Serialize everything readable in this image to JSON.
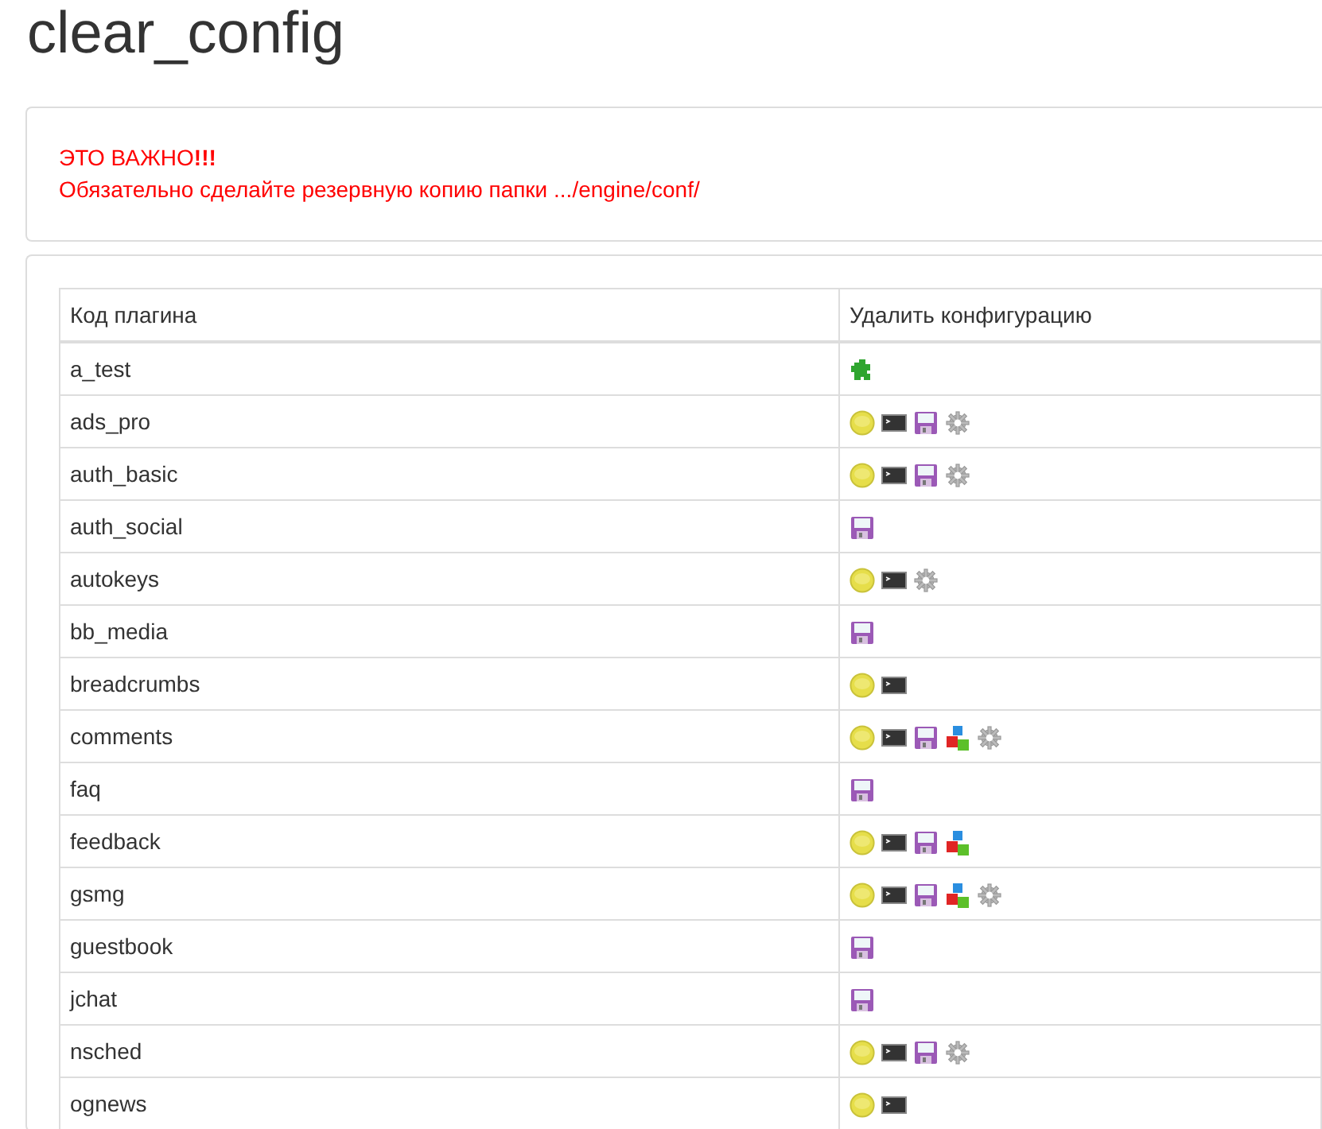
{
  "title": "clear_config",
  "notice": [
    "ЭТО ВАЖНО**!!!**",
    "Обязательно сделайте резервную копию папки .../engine/conf/"
  ],
  "table": {
    "columns": [
      "Код плагина",
      "Удалить конфигурацию"
    ],
    "rows": [
      {
        "plugin": "a_test",
        "icons": [
          {
            "kind": "puzzle"
          }
        ]
      },
      {
        "plugin": "ads_pro",
        "icons": [
          {
            "kind": "coin"
          },
          {
            "kind": "terminal"
          },
          {
            "kind": "disk"
          },
          {
            "kind": "gear"
          }
        ]
      },
      {
        "plugin": "auth_basic",
        "icons": [
          {
            "kind": "coin"
          },
          {
            "kind": "terminal"
          },
          {
            "kind": "disk"
          },
          {
            "kind": "gear"
          }
        ]
      },
      {
        "plugin": "auth_social",
        "icons": [
          {
            "kind": "disk"
          }
        ]
      },
      {
        "plugin": "autokeys",
        "icons": [
          {
            "kind": "coin"
          },
          {
            "kind": "terminal"
          },
          {
            "kind": "gear"
          }
        ]
      },
      {
        "plugin": "bb_media",
        "icons": [
          {
            "kind": "disk"
          }
        ]
      },
      {
        "plugin": "breadcrumbs",
        "icons": [
          {
            "kind": "coin"
          },
          {
            "kind": "terminal"
          }
        ]
      },
      {
        "plugin": "comments",
        "icons": [
          {
            "kind": "coin"
          },
          {
            "kind": "terminal"
          },
          {
            "kind": "disk"
          },
          {
            "kind": "blocks"
          },
          {
            "kind": "gear"
          }
        ]
      },
      {
        "plugin": "faq",
        "icons": [
          {
            "kind": "disk"
          }
        ]
      },
      {
        "plugin": "feedback",
        "icons": [
          {
            "kind": "coin"
          },
          {
            "kind": "terminal"
          },
          {
            "kind": "disk"
          },
          {
            "kind": "blocks"
          }
        ]
      },
      {
        "plugin": "gsmg",
        "icons": [
          {
            "kind": "coin"
          },
          {
            "kind": "terminal"
          },
          {
            "kind": "disk"
          },
          {
            "kind": "blocks"
          },
          {
            "kind": "gear"
          }
        ]
      },
      {
        "plugin": "guestbook",
        "icons": [
          {
            "kind": "disk"
          }
        ]
      },
      {
        "plugin": "jchat",
        "icons": [
          {
            "kind": "disk"
          }
        ]
      },
      {
        "plugin": "nsched",
        "icons": [
          {
            "kind": "coin"
          },
          {
            "kind": "terminal"
          },
          {
            "kind": "disk"
          },
          {
            "kind": "gear"
          }
        ]
      },
      {
        "plugin": "ognews",
        "icons": [
          {
            "kind": "coin"
          },
          {
            "kind": "terminal"
          }
        ]
      }
    ]
  }
}
